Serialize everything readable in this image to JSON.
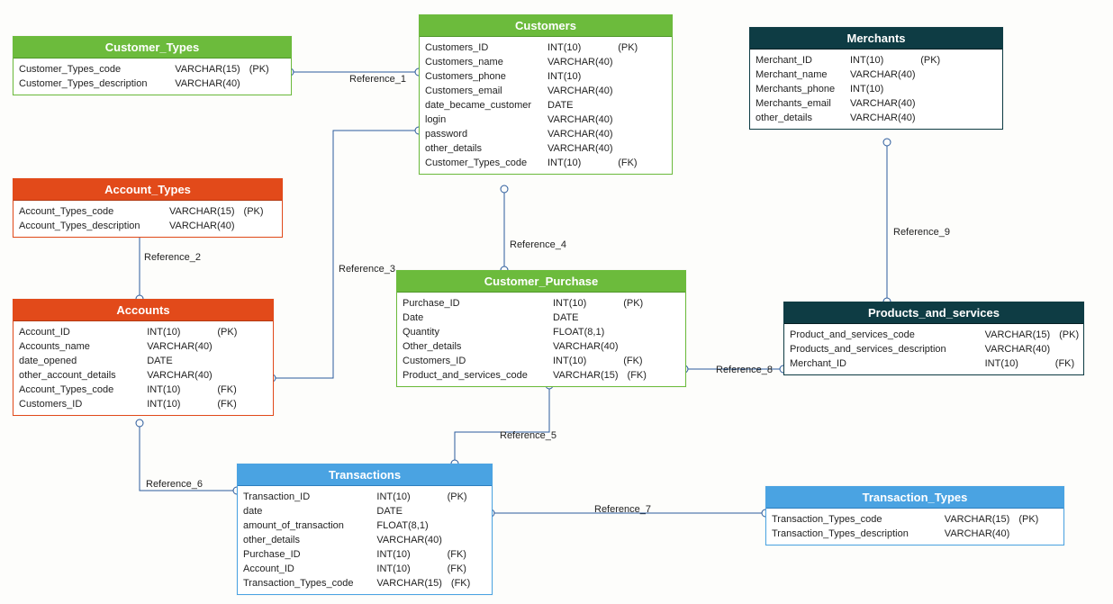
{
  "entities": {
    "customer_types": {
      "title": "Customer_Types",
      "cols": [
        {
          "name": "Customer_Types_code",
          "type": "VARCHAR(15)",
          "key": "(PK)"
        },
        {
          "name": "Customer_Types_description",
          "type": "VARCHAR(40)",
          "key": ""
        }
      ]
    },
    "customers": {
      "title": "Customers",
      "cols": [
        {
          "name": "Customers_ID",
          "type": "INT(10)",
          "key": "(PK)"
        },
        {
          "name": "Customers_name",
          "type": "VARCHAR(40)",
          "key": ""
        },
        {
          "name": "Customers_phone",
          "type": "INT(10)",
          "key": ""
        },
        {
          "name": "Customers_email",
          "type": "VARCHAR(40)",
          "key": ""
        },
        {
          "name": "date_became_customer",
          "type": "DATE",
          "key": ""
        },
        {
          "name": "login",
          "type": "VARCHAR(40)",
          "key": ""
        },
        {
          "name": "password",
          "type": "VARCHAR(40)",
          "key": ""
        },
        {
          "name": "other_details",
          "type": "VARCHAR(40)",
          "key": ""
        },
        {
          "name": "Customer_Types_code",
          "type": "INT(10)",
          "key": "(FK)"
        }
      ]
    },
    "merchants": {
      "title": "Merchants",
      "cols": [
        {
          "name": "Merchant_ID",
          "type": "INT(10)",
          "key": "(PK)"
        },
        {
          "name": "Merchant_name",
          "type": "VARCHAR(40)",
          "key": ""
        },
        {
          "name": "Merchants_phone",
          "type": "INT(10)",
          "key": ""
        },
        {
          "name": "Merchants_email",
          "type": "VARCHAR(40)",
          "key": ""
        },
        {
          "name": "other_details",
          "type": "VARCHAR(40)",
          "key": ""
        }
      ]
    },
    "account_types": {
      "title": "Account_Types",
      "cols": [
        {
          "name": "Account_Types_code",
          "type": "VARCHAR(15)",
          "key": "(PK)"
        },
        {
          "name": "Account_Types_description",
          "type": "VARCHAR(40)",
          "key": ""
        }
      ]
    },
    "accounts": {
      "title": "Accounts",
      "cols": [
        {
          "name": "Account_ID",
          "type": "INT(10)",
          "key": "(PK)"
        },
        {
          "name": "Accounts_name",
          "type": "VARCHAR(40)",
          "key": ""
        },
        {
          "name": "date_opened",
          "type": "DATE",
          "key": ""
        },
        {
          "name": "other_account_details",
          "type": "VARCHAR(40)",
          "key": ""
        },
        {
          "name": "Account_Types_code",
          "type": "INT(10)",
          "key": "(FK)"
        },
        {
          "name": "Customers_ID",
          "type": "INT(10)",
          "key": "(FK)"
        }
      ]
    },
    "customer_purchase": {
      "title": "Customer_Purchase",
      "cols": [
        {
          "name": "Purchase_ID",
          "type": "INT(10)",
          "key": "(PK)"
        },
        {
          "name": "Date",
          "type": "DATE",
          "key": ""
        },
        {
          "name": "Quantity",
          "type": "FLOAT(8,1)",
          "key": ""
        },
        {
          "name": "Other_details",
          "type": "VARCHAR(40)",
          "key": ""
        },
        {
          "name": "Customers_ID",
          "type": "INT(10)",
          "key": "(FK)"
        },
        {
          "name": "Product_and_services_code",
          "type": "VARCHAR(15)",
          "key": "(FK)"
        }
      ]
    },
    "products_and_services": {
      "title": "Products_and_services",
      "cols": [
        {
          "name": "Product_and_services_code",
          "type": "VARCHAR(15)",
          "key": "(PK)"
        },
        {
          "name": "Products_and_services_description",
          "type": "VARCHAR(40)",
          "key": ""
        },
        {
          "name": "Merchant_ID",
          "type": "INT(10)",
          "key": "(FK)"
        }
      ]
    },
    "transactions": {
      "title": "Transactions",
      "cols": [
        {
          "name": "Transaction_ID",
          "type": "INT(10)",
          "key": "(PK)"
        },
        {
          "name": "date",
          "type": "DATE",
          "key": ""
        },
        {
          "name": "amount_of_transaction",
          "type": "FLOAT(8,1)",
          "key": ""
        },
        {
          "name": "other_details",
          "type": "VARCHAR(40)",
          "key": ""
        },
        {
          "name": "Purchase_ID",
          "type": "INT(10)",
          "key": "(FK)"
        },
        {
          "name": "Account_ID",
          "type": "INT(10)",
          "key": "(FK)"
        },
        {
          "name": "Transaction_Types_code",
          "type": "VARCHAR(15)",
          "key": "(FK)"
        }
      ]
    },
    "transaction_types": {
      "title": "Transaction_Types",
      "cols": [
        {
          "name": "Transaction_Types_code",
          "type": "VARCHAR(15)",
          "key": "(PK)"
        },
        {
          "name": "Transaction_Types_description",
          "type": "VARCHAR(40)",
          "key": ""
        }
      ]
    }
  },
  "refs": {
    "r1": "Reference_1",
    "r2": "Reference_2",
    "r3": "Reference_3",
    "r4": "Reference_4",
    "r5": "Reference_5",
    "r6": "Reference_6",
    "r7": "Reference_7",
    "r8": "Reference_8",
    "r9": "Reference_9"
  }
}
